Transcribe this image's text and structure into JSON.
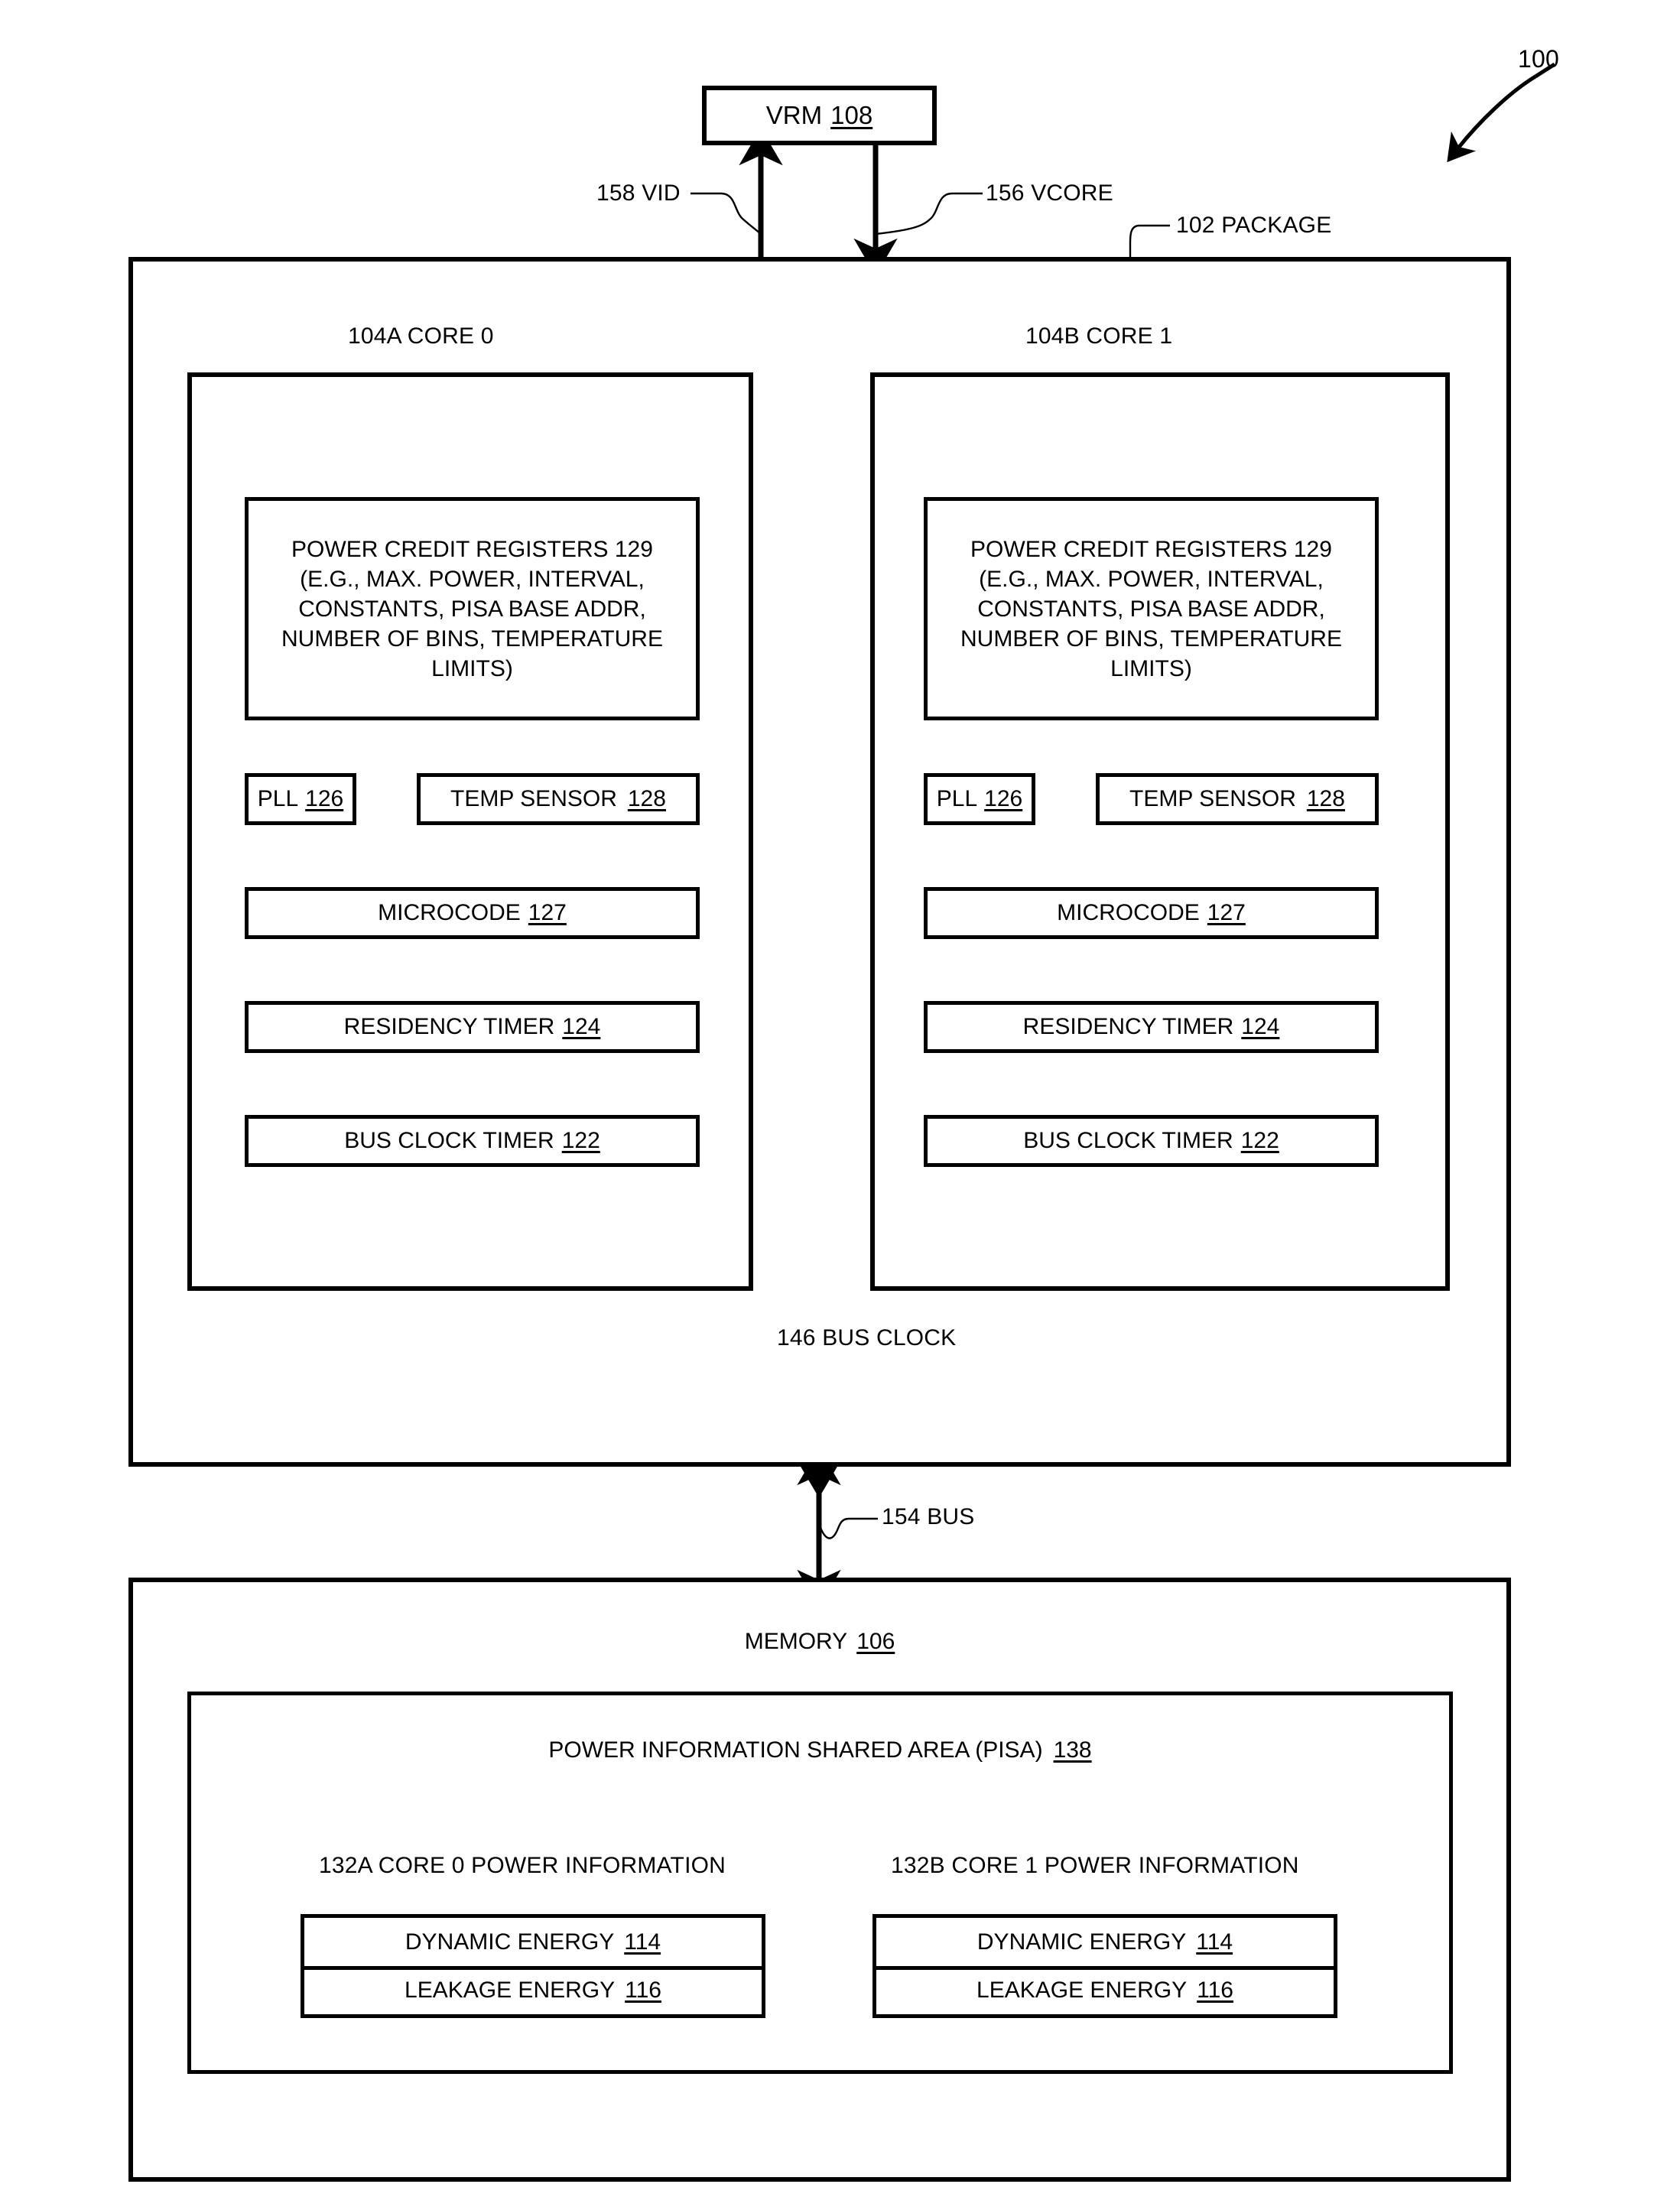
{
  "figure": {
    "ref_number": "100"
  },
  "vrm": {
    "label": "VRM",
    "ref": "108"
  },
  "signals": {
    "vid": "158 VID",
    "vcore": "156 VCORE",
    "bus_clock": "146 BUS CLOCK",
    "bus": "154 BUS"
  },
  "package": {
    "label": "102 PACKAGE"
  },
  "cores": [
    {
      "header": "104A CORE 0",
      "power_credit_registers": {
        "lines": [
          "POWER CREDIT REGISTERS  129",
          "(E.G., MAX. POWER, INTERVAL,",
          "CONSTANTS, PISA BASE ADDR,",
          "NUMBER OF BINS, TEMPERATURE",
          "LIMITS)"
        ],
        "title": "POWER CREDIT REGISTERS",
        "ref": "129"
      },
      "pll": {
        "label": "PLL",
        "ref": "126"
      },
      "temp_sensor": {
        "label": "TEMP SENSOR",
        "ref": "128"
      },
      "microcode": {
        "label": "MICROCODE",
        "ref": "127"
      },
      "residency_timer": {
        "label": "RESIDENCY TIMER",
        "ref": "124"
      },
      "bus_clock_timer": {
        "label": "BUS CLOCK TIMER",
        "ref": "122"
      }
    },
    {
      "header": "104B CORE 1",
      "power_credit_registers": {
        "lines": [
          "POWER CREDIT REGISTERS  129",
          "(E.G., MAX. POWER, INTERVAL,",
          "CONSTANTS, PISA BASE ADDR,",
          "NUMBER OF BINS, TEMPERATURE",
          "LIMITS)"
        ],
        "title": "POWER CREDIT REGISTERS",
        "ref": "129"
      },
      "pll": {
        "label": "PLL",
        "ref": "126"
      },
      "temp_sensor": {
        "label": "TEMP SENSOR",
        "ref": "128"
      },
      "microcode": {
        "label": "MICROCODE",
        "ref": "127"
      },
      "residency_timer": {
        "label": "RESIDENCY TIMER",
        "ref": "124"
      },
      "bus_clock_timer": {
        "label": "BUS CLOCK TIMER",
        "ref": "122"
      }
    }
  ],
  "memory": {
    "label": "MEMORY",
    "ref": "106",
    "pisa": {
      "label": "POWER INFORMATION SHARED AREA (PISA)",
      "ref": "138",
      "core_info": [
        {
          "header": "132A CORE 0 POWER INFORMATION",
          "dynamic_energy": {
            "label": "DYNAMIC ENERGY",
            "ref": "114"
          },
          "leakage_energy": {
            "label": "LEAKAGE ENERGY",
            "ref": "116"
          }
        },
        {
          "header": "132B CORE 1 POWER INFORMATION",
          "dynamic_energy": {
            "label": "DYNAMIC ENERGY",
            "ref": "114"
          },
          "leakage_energy": {
            "label": "LEAKAGE ENERGY",
            "ref": "116"
          }
        }
      ]
    }
  }
}
